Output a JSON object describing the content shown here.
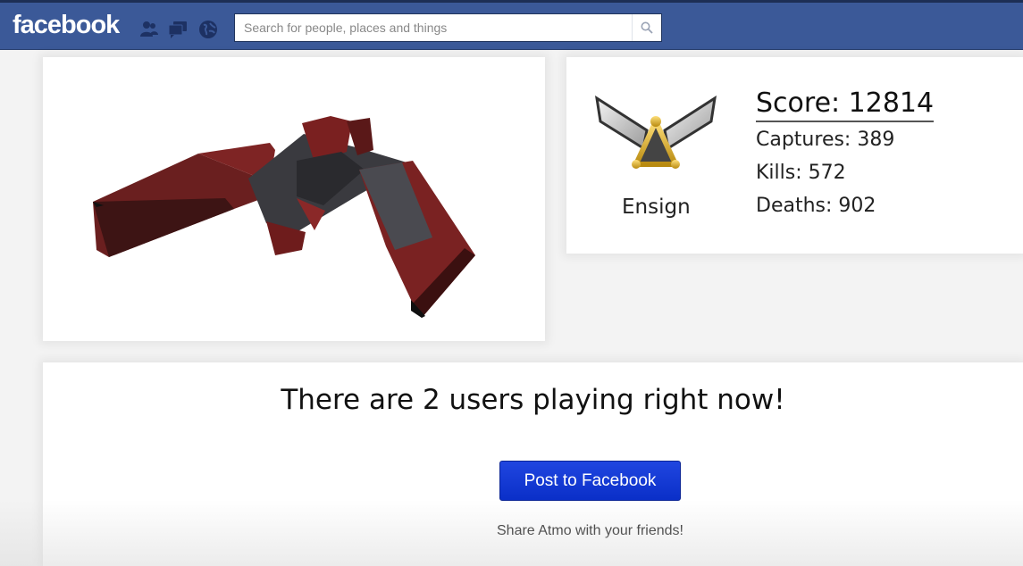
{
  "topbar": {
    "logo": "facebook",
    "jewels": [
      "friend-requests-icon",
      "messages-icon",
      "notifications-icon"
    ],
    "search_placeholder": "Search for people, places and things",
    "brand_color": "#3b5998"
  },
  "stats": {
    "rank": "Ensign",
    "score": "Score: 12814",
    "captures": "Captures: 389",
    "kills": "Kills: 572",
    "deaths": "Deaths: 902"
  },
  "main": {
    "playing_text": "There are 2 users playing right now!",
    "post_button": "Post to Facebook",
    "share_text": "Share Atmo with your friends!",
    "button_color": "#1a3fd6"
  }
}
